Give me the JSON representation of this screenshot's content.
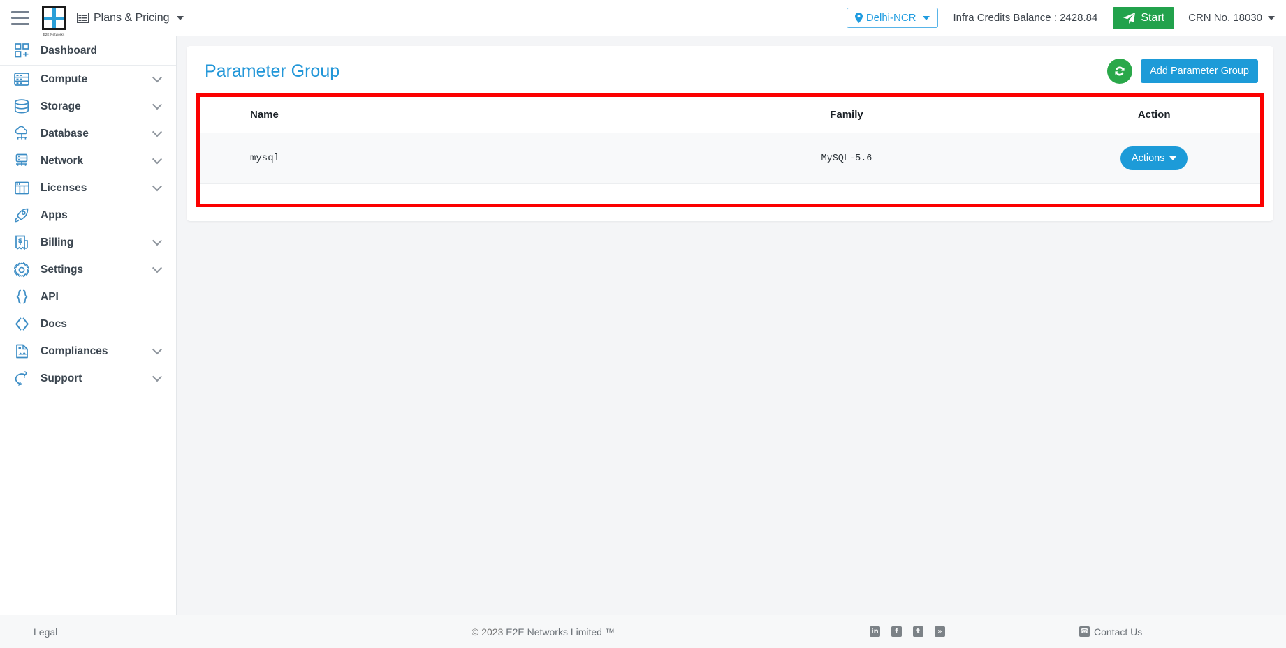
{
  "topbar": {
    "menu_icon": "hamburger-icon",
    "logo_text": "E2E Networks",
    "plans_label": "Plans & Pricing",
    "region_label": "Delhi-NCR",
    "credits_label": "Infra Credits Balance : 2428.84",
    "start_label": "Start",
    "crn_label": "CRN No. 18030"
  },
  "sidebar": {
    "items": [
      {
        "label": "Dashboard",
        "icon": "dashboard-icon",
        "chevron": false
      },
      {
        "label": "Compute",
        "icon": "server-icon",
        "chevron": true
      },
      {
        "label": "Storage",
        "icon": "database-disk-icon",
        "chevron": true
      },
      {
        "label": "Database",
        "icon": "cloud-database-icon",
        "chevron": true
      },
      {
        "label": "Network",
        "icon": "network-icon",
        "chevron": true
      },
      {
        "label": "Licenses",
        "icon": "license-grid-icon",
        "chevron": true
      },
      {
        "label": "Apps",
        "icon": "rocket-icon",
        "chevron": false
      },
      {
        "label": "Billing",
        "icon": "invoice-dollar-icon",
        "chevron": true
      },
      {
        "label": "Settings",
        "icon": "gear-icon",
        "chevron": true
      },
      {
        "label": "API",
        "icon": "braces-icon",
        "chevron": false
      },
      {
        "label": "Docs",
        "icon": "code-angle-icon",
        "chevron": false
      },
      {
        "label": "Compliances",
        "icon": "document-check-icon",
        "chevron": true
      },
      {
        "label": "Support",
        "icon": "chat-support-icon",
        "chevron": true
      }
    ]
  },
  "main": {
    "page_title": "Parameter Group",
    "refresh_label": "refresh-icon",
    "add_button_label": "Add Parameter Group",
    "table": {
      "columns": [
        "Name",
        "Family",
        "Action"
      ],
      "rows": [
        {
          "name": "mysql",
          "family": "MySQL-5.6",
          "action_label": "Actions"
        }
      ]
    }
  },
  "footer": {
    "legal": "Legal",
    "copyright_year": "© 2023",
    "copyright_company": "E2E Networks Limited ™",
    "social": [
      {
        "name": "linkedin-icon",
        "glyph": "in"
      },
      {
        "name": "facebook-icon",
        "glyph": "f"
      },
      {
        "name": "twitter-icon",
        "glyph": "t"
      },
      {
        "name": "rss-icon",
        "glyph": "»"
      }
    ],
    "contact_label": "Contact Us"
  },
  "colors": {
    "accent_blue": "#1d9bd8",
    "title_blue": "#2196d8",
    "green": "#22a24c",
    "refresh_green": "#2aa84a",
    "highlight_red": "#fb0000",
    "sidebar_icon_blue": "#3c8dc5"
  }
}
